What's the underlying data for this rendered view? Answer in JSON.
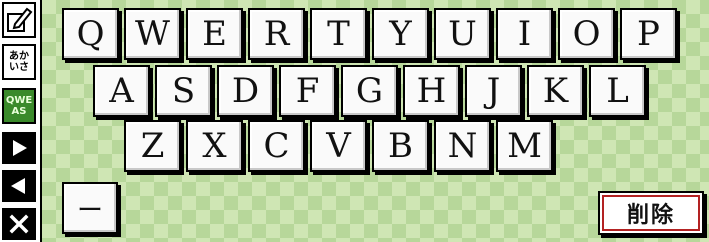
{
  "sidebar": {
    "buttons": [
      {
        "name": "handwriting-mode-button",
        "icon": "pencil-icon"
      },
      {
        "name": "hiragana-mode-button",
        "label": "あか\nいさ"
      },
      {
        "name": "qwerty-mode-button",
        "label": "QWE\nAS",
        "active": true
      },
      {
        "name": "next-button",
        "icon": "triangle-right-icon"
      },
      {
        "name": "back-button",
        "icon": "triangle-left-icon"
      },
      {
        "name": "close-button",
        "icon": "close-icon"
      }
    ]
  },
  "keyboard": {
    "rows": [
      [
        "Q",
        "W",
        "E",
        "R",
        "T",
        "Y",
        "U",
        "I",
        "O",
        "P"
      ],
      [
        "A",
        "S",
        "D",
        "F",
        "G",
        "H",
        "J",
        "K",
        "L"
      ],
      [
        "Z",
        "X",
        "C",
        "V",
        "B",
        "N",
        "M"
      ]
    ],
    "dash_key": "ー",
    "delete_label": "削除"
  },
  "colors": {
    "background": "#cfe6b4",
    "checker": "#b7d79a",
    "active_mode": "#3a8a2a",
    "delete_accent": "#b32222"
  }
}
